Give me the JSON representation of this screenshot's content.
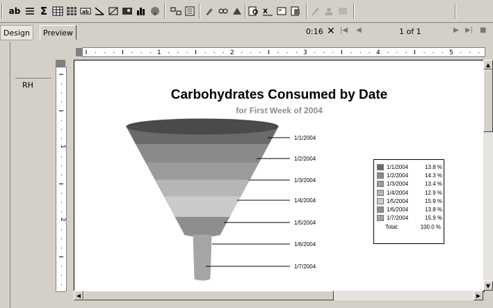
{
  "toolbar": {
    "text_tool_label": "ab",
    "icons": [
      "list-icon",
      "sum-icon",
      "table-icon",
      "grid-icon",
      "field-icon",
      "line-icon",
      "box-icon",
      "image-icon",
      "chart-icon",
      "map-icon",
      "align-icon",
      "format-icon",
      "brush-icon",
      "link-icon",
      "expert-icon",
      "search-icon",
      "xsum-icon",
      "report-icon",
      "page-icon",
      "pen-icon",
      "user-icon",
      "grey-icon"
    ]
  },
  "tabs": {
    "design": "Design",
    "preview": "Preview"
  },
  "preview_nav": {
    "time": "0:16",
    "page_label": "1 of 1"
  },
  "ruler": {
    "h_marks": [
      "1",
      "2",
      "3",
      "4",
      "5"
    ],
    "v_marks": [
      "1",
      "2"
    ]
  },
  "section": {
    "label": "RH"
  },
  "chart_data": {
    "type": "funnel",
    "title": "Carbohydrates Consumed by Date",
    "subtitle": "for First Week of 2004",
    "categories": [
      "1/1/2004",
      "1/2/2004",
      "1/3/2004",
      "1/4/2004",
      "1/5/2004",
      "1/6/2004",
      "1/7/2004"
    ],
    "values": [
      13.8,
      14.3,
      13.4,
      12.9,
      15.9,
      13.8,
      15.9
    ],
    "value_labels": [
      "13.8 %",
      "14.3 %",
      "13.4 %",
      "12.9 %",
      "15.9 %",
      "13.8 %",
      "15.9 %"
    ],
    "colors": [
      "#6a6a6a",
      "#8a8a8a",
      "#9c9c9c",
      "#b6b6b6",
      "#cacaca",
      "#8e8e8e",
      "#a5a5a5"
    ],
    "total_label": "Total:",
    "total_value": "100.0 %",
    "legend_position": "right"
  }
}
